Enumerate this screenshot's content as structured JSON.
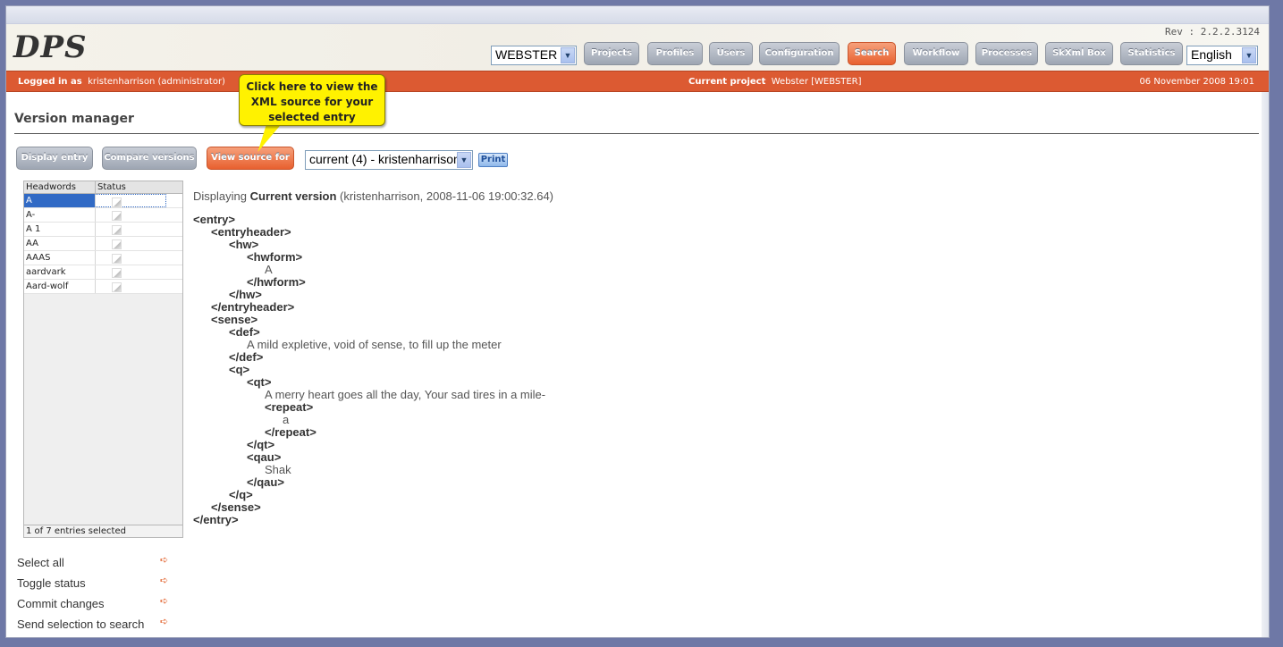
{
  "header": {
    "logo": "DPS",
    "revision": "Rev : 2.2.2.3124",
    "project_select": "WEBSTER",
    "language_select": "English",
    "nav": [
      "Projects",
      "Profiles",
      "Users",
      "Configuration",
      "Search",
      "Workflow",
      "Processes",
      "SkXml Box",
      "Statistics"
    ],
    "active_nav": "Search"
  },
  "statusbar": {
    "logged_in_label": "Logged in as",
    "logged_in_user": "kristenharrison (administrator)",
    "current_project_label": "Current project",
    "current_project_value": "Webster [WEBSTER]",
    "datetime": "06 November 2008 19:01",
    "color": "#dc5a32"
  },
  "page": {
    "title": "Version manager",
    "buttons": [
      "Display entry",
      "Compare versions",
      "View source for"
    ],
    "version_select": "current (4) - kristenharrison",
    "print_label": "Print",
    "callout": "Click here to view the XML source for your selected entry"
  },
  "headwords": {
    "columns": [
      "Headwords",
      "Status"
    ],
    "rows": [
      "A",
      "A-",
      "A 1",
      "AA",
      "AAAS",
      "aardvark",
      "Aard-wolf"
    ],
    "selected_index": 0,
    "footer": "1 of 7 entries selected"
  },
  "actions": [
    "Select all",
    "Toggle status",
    "Commit changes",
    "Send selection to search"
  ],
  "source": {
    "display_prefix": "Displaying",
    "display_version": "Current version",
    "display_suffix": "(kristenharrison, 2008-11-06 19:00:32.64)",
    "lines": [
      {
        "indent": 0,
        "tag": true,
        "text": "<entry>"
      },
      {
        "indent": 1,
        "tag": true,
        "text": "<entryheader>"
      },
      {
        "indent": 2,
        "tag": true,
        "text": "<hw>"
      },
      {
        "indent": 3,
        "tag": true,
        "text": "<hwform>"
      },
      {
        "indent": 4,
        "tag": false,
        "text": "A"
      },
      {
        "indent": 3,
        "tag": true,
        "text": "</hwform>"
      },
      {
        "indent": 2,
        "tag": true,
        "text": "</hw>"
      },
      {
        "indent": 1,
        "tag": true,
        "text": "</entryheader>"
      },
      {
        "indent": 1,
        "tag": true,
        "text": "<sense>"
      },
      {
        "indent": 2,
        "tag": true,
        "text": "<def>"
      },
      {
        "indent": 3,
        "tag": false,
        "text": "A mild expletive, void of sense, to fill up the meter"
      },
      {
        "indent": 2,
        "tag": true,
        "text": "</def>"
      },
      {
        "indent": 2,
        "tag": true,
        "text": "<q>"
      },
      {
        "indent": 3,
        "tag": true,
        "text": "<qt>"
      },
      {
        "indent": 4,
        "tag": false,
        "text": "A merry heart goes all the day, Your sad tires in a mile-"
      },
      {
        "indent": 4,
        "tag": true,
        "text": "<repeat>"
      },
      {
        "indent": 5,
        "tag": false,
        "text": "a"
      },
      {
        "indent": 4,
        "tag": true,
        "text": "</repeat>"
      },
      {
        "indent": 3,
        "tag": true,
        "text": "</qt>"
      },
      {
        "indent": 3,
        "tag": true,
        "text": "<qau>"
      },
      {
        "indent": 4,
        "tag": false,
        "text": "Shak"
      },
      {
        "indent": 3,
        "tag": true,
        "text": "</qau>"
      },
      {
        "indent": 2,
        "tag": true,
        "text": "</q>"
      },
      {
        "indent": 1,
        "tag": true,
        "text": "</sense>"
      },
      {
        "indent": 0,
        "tag": true,
        "text": "</entry>"
      }
    ]
  }
}
